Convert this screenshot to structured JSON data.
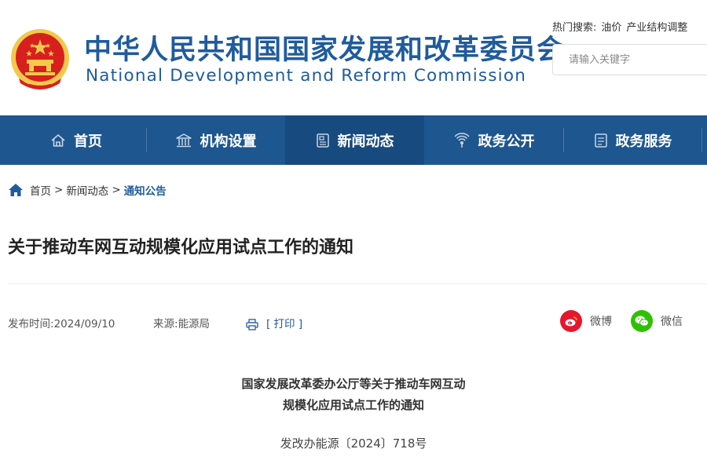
{
  "header": {
    "title_cn": "中华人民共和国国家发展和改革委员会",
    "title_en": "National Development and Reform Commission",
    "hot_search_label": "热门搜索:",
    "hot_search_items": [
      "油价",
      "产业结构调整"
    ],
    "search": {
      "placeholder": "请输入关键字",
      "value": ""
    },
    "emblem_icon": "national-emblem-icon"
  },
  "nav": {
    "items": [
      {
        "label": "首页",
        "icon": "home-outline-icon",
        "active": false
      },
      {
        "label": "机构设置",
        "icon": "institution-building-icon",
        "active": false
      },
      {
        "label": "新闻动态",
        "icon": "news-document-icon",
        "active": true
      },
      {
        "label": "政务公开",
        "icon": "broadcast-signal-icon",
        "active": false
      },
      {
        "label": "政务服务",
        "icon": "service-document-icon",
        "active": false
      }
    ]
  },
  "breadcrumb": {
    "items": [
      "首页",
      "新闻动态"
    ],
    "current": "通知公告",
    "separator": ">"
  },
  "article": {
    "title": "关于推动车网互动规模化应用试点工作的通知",
    "publish_label": "发布时间:",
    "publish_date": "2024/09/10",
    "source_label": "来源:",
    "source": "能源局",
    "print_label": "[ 打印 ]",
    "share": [
      {
        "label": "微博",
        "icon": "weibo-icon",
        "color": "#e6162d"
      },
      {
        "label": "微信",
        "icon": "wechat-icon",
        "color": "#2dc100"
      }
    ],
    "doc_heading_lines": [
      "国家发展改革委办公厅等关于推动车网互动",
      "规模化应用试点工作的通知"
    ],
    "doc_number": "发改办能源〔2024〕718号"
  },
  "colors": {
    "brand_blue": "#1f5b9e",
    "nav_bg": "#1e568f",
    "nav_active_bg": "#174a7e",
    "emblem_red": "#d7201e",
    "emblem_gold": "#f2c94c"
  }
}
